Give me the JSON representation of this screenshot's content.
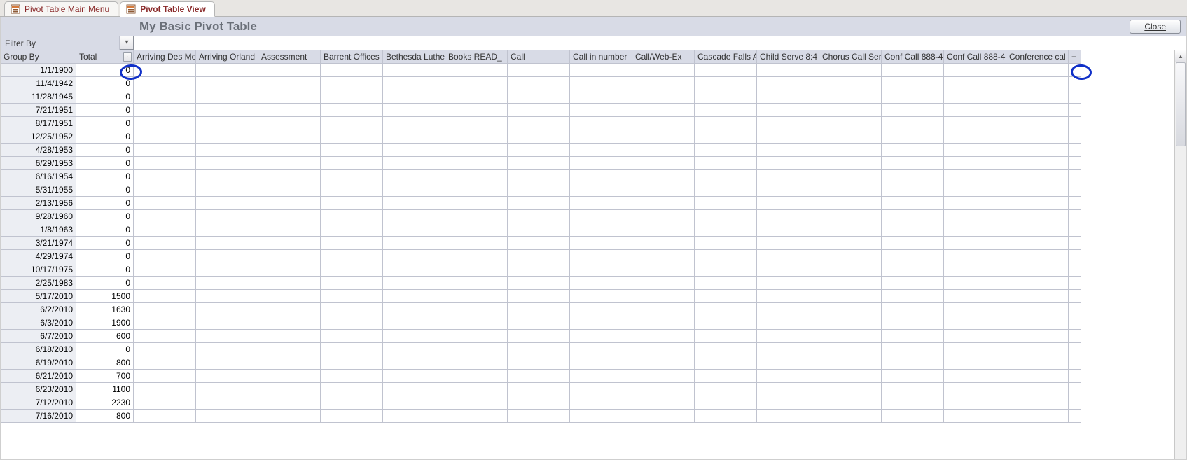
{
  "tabs": [
    {
      "label": "Pivot Table Main Menu",
      "active": false
    },
    {
      "label": "Pivot Table View",
      "active": true
    }
  ],
  "title": "My Basic Pivot Table",
  "close_label": "Close",
  "filter_by_label": "Filter By",
  "group_by_label": "Group By",
  "total_label": "Total",
  "plus_label": "+",
  "sort_indicator": "-",
  "columns": [
    "Arriving Des Mo",
    "Arriving Orland",
    "Assessment",
    "Barrent Offices",
    "Bethesda Luthe",
    "Books READ_",
    "Call",
    "Call in number",
    "Call/Web-Ex",
    "Cascade Falls A",
    "Child Serve 8:4",
    "Chorus Call Ser",
    "Conf Call 888-4",
    "Conf Call 888-4",
    "Conference cal"
  ],
  "rows": [
    {
      "date": "1/1/1900",
      "total": "0"
    },
    {
      "date": "11/4/1942",
      "total": "0"
    },
    {
      "date": "11/28/1945",
      "total": "0"
    },
    {
      "date": "7/21/1951",
      "total": "0"
    },
    {
      "date": "8/17/1951",
      "total": "0"
    },
    {
      "date": "12/25/1952",
      "total": "0"
    },
    {
      "date": "4/28/1953",
      "total": "0"
    },
    {
      "date": "6/29/1953",
      "total": "0"
    },
    {
      "date": "6/16/1954",
      "total": "0"
    },
    {
      "date": "5/31/1955",
      "total": "0"
    },
    {
      "date": "2/13/1956",
      "total": "0"
    },
    {
      "date": "9/28/1960",
      "total": "0"
    },
    {
      "date": "1/8/1963",
      "total": "0"
    },
    {
      "date": "3/21/1974",
      "total": "0"
    },
    {
      "date": "4/29/1974",
      "total": "0"
    },
    {
      "date": "10/17/1975",
      "total": "0"
    },
    {
      "date": "2/25/1983",
      "total": "0"
    },
    {
      "date": "5/17/2010",
      "total": "1500"
    },
    {
      "date": "6/2/2010",
      "total": "1630"
    },
    {
      "date": "6/3/2010",
      "total": "1900"
    },
    {
      "date": "6/7/2010",
      "total": "600"
    },
    {
      "date": "6/18/2010",
      "total": "0"
    },
    {
      "date": "6/19/2010",
      "total": "800"
    },
    {
      "date": "6/21/2010",
      "total": "700"
    },
    {
      "date": "6/23/2010",
      "total": "1100"
    },
    {
      "date": "7/12/2010",
      "total": "2230"
    },
    {
      "date": "7/16/2010",
      "total": "800"
    }
  ],
  "col_widths": {
    "groupby": 108,
    "total": 82,
    "data": 89,
    "plus": 18
  }
}
